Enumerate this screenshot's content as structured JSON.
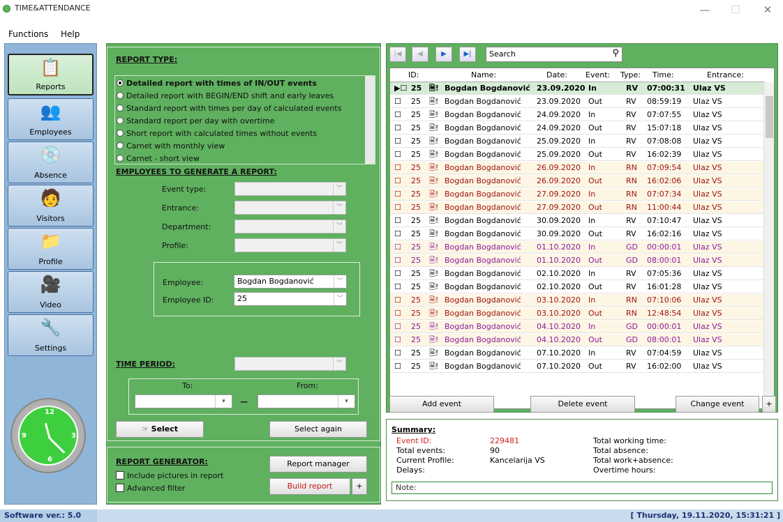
{
  "app": {
    "title": "TIME&ATTENDANCE"
  },
  "menu": [
    "Functions",
    "Help"
  ],
  "sidebar": [
    {
      "label": "Reports",
      "icon": "reports-icon"
    },
    {
      "label": "Employees",
      "icon": "employees-icon"
    },
    {
      "label": "Absence",
      "icon": "absence-icon"
    },
    {
      "label": "Visitors",
      "icon": "visitors-icon"
    },
    {
      "label": "Profile",
      "icon": "profile-icon"
    },
    {
      "label": "Video",
      "icon": "video-icon"
    },
    {
      "label": "Settings",
      "icon": "settings-icon"
    }
  ],
  "report_type": {
    "heading": "REPORT TYPE:",
    "options": [
      "Detailed report with times of IN/OUT events",
      "Detailed report with BEGIN/END shift and early leaves",
      "Standard report with times per day of calculated events",
      "Standard report per day with overtime",
      "Short report with calculated times without events",
      "Carnet with monthly view",
      "Carnet - short view"
    ]
  },
  "employees": {
    "heading": "EMPLOYEES TO GENERATE A REPORT:",
    "event_type": "Event type:",
    "entrance": "Entrance:",
    "department": "Department:",
    "profile": "Profile:",
    "employee_label": "Employee:",
    "employee_value": "Bogdan Bogdanović",
    "employee_id_label": "Employee ID:",
    "employee_id_value": "25"
  },
  "time_period": {
    "heading": "TIME PERIOD:",
    "to": "To:",
    "from": "From:"
  },
  "buttons": {
    "select": "Select",
    "select_again": "Select again",
    "report_manager": "Report manager",
    "build_report": "Build report",
    "plus": "+",
    "add_event": "Add event",
    "delete_event": "Delete event",
    "change_event": "Change event"
  },
  "generator": {
    "heading": "REPORT GENERATOR:",
    "include_pictures": "Include pictures in report",
    "advanced_filter": "Advanced filter"
  },
  "search": {
    "placeholder": "Search"
  },
  "table": {
    "headers": [
      "ID:",
      "Name:",
      "Date:",
      "Event:",
      "Type:",
      "Time:",
      "Entrance:"
    ],
    "rows": [
      [
        "25",
        "Bogdan Bogdanović",
        "23.09.2020",
        "In",
        "RV",
        "07:00:31",
        "Ulaz VS"
      ],
      [
        "25",
        "Bogdan Bogdanović",
        "23.09.2020",
        "Out",
        "RV",
        "08:59:19",
        "Ulaz VS"
      ],
      [
        "25",
        "Bogdan Bogdanović",
        "24.09.2020",
        "In",
        "RV",
        "07:07:55",
        "Ulaz VS"
      ],
      [
        "25",
        "Bogdan Bogdanović",
        "24.09.2020",
        "Out",
        "RV",
        "15:07:18",
        "Ulaz VS"
      ],
      [
        "25",
        "Bogdan Bogdanović",
        "25.09.2020",
        "In",
        "RV",
        "07:08:08",
        "Ulaz VS"
      ],
      [
        "25",
        "Bogdan Bogdanović",
        "25.09.2020",
        "Out",
        "RV",
        "16:02:39",
        "Ulaz VS"
      ],
      [
        "25",
        "Bogdan Bogdanović",
        "26.09.2020",
        "In",
        "RN",
        "07:09:54",
        "Ulaz VS"
      ],
      [
        "25",
        "Bogdan Bogdanović",
        "26.09.2020",
        "Out",
        "RN",
        "16:02:06",
        "Ulaz VS"
      ],
      [
        "25",
        "Bogdan Bogdanović",
        "27.09.2020",
        "In",
        "RN",
        "07:07:34",
        "Ulaz VS"
      ],
      [
        "25",
        "Bogdan Bogdanović",
        "27.09.2020",
        "Out",
        "RN",
        "11:00:44",
        "Ulaz VS"
      ],
      [
        "25",
        "Bogdan Bogdanović",
        "30.09.2020",
        "In",
        "RV",
        "07:10:47",
        "Ulaz VS"
      ],
      [
        "25",
        "Bogdan Bogdanović",
        "30.09.2020",
        "Out",
        "RV",
        "16:02:16",
        "Ulaz VS"
      ],
      [
        "25",
        "Bogdan Bogdanović",
        "01.10.2020",
        "In",
        "GD",
        "00:00:01",
        "Ulaz VS"
      ],
      [
        "25",
        "Bogdan Bogdanović",
        "01.10.2020",
        "Out",
        "GD",
        "08:00:01",
        "Ulaz VS"
      ],
      [
        "25",
        "Bogdan Bogdanović",
        "02.10.2020",
        "In",
        "RV",
        "07:05:36",
        "Ulaz VS"
      ],
      [
        "25",
        "Bogdan Bogdanović",
        "02.10.2020",
        "Out",
        "RV",
        "16:01:28",
        "Ulaz VS"
      ],
      [
        "25",
        "Bogdan Bogdanović",
        "03.10.2020",
        "In",
        "RN",
        "07:10:06",
        "Ulaz VS"
      ],
      [
        "25",
        "Bogdan Bogdanović",
        "03.10.2020",
        "Out",
        "RN",
        "12:48:54",
        "Ulaz VS"
      ],
      [
        "25",
        "Bogdan Bogdanović",
        "04.10.2020",
        "In",
        "GD",
        "00:00:01",
        "Ulaz VS"
      ],
      [
        "25",
        "Bogdan Bogdanović",
        "04.10.2020",
        "Out",
        "GD",
        "08:00:01",
        "Ulaz VS"
      ],
      [
        "25",
        "Bogdan Bogdanović",
        "07.10.2020",
        "In",
        "RV",
        "07:04:59",
        "Ulaz VS"
      ],
      [
        "25",
        "Bogdan Bogdanović",
        "07.10.2020",
        "Out",
        "RV",
        "16:02:00",
        "Ulaz VS"
      ]
    ]
  },
  "summary": {
    "heading": "Summary:",
    "event_id_label": "Event ID:",
    "event_id": "229481",
    "total_events_label": "Total events:",
    "total_events": "90",
    "profile_label": "Current Profile:",
    "profile": "Kancelarija VS",
    "delays_label": "Delays:",
    "total_working": "Total working time:",
    "total_absence": "Total absence:",
    "total_work_absence": "Total work+absence:",
    "overtime": "Overtime hours:",
    "note": "Note:"
  },
  "status": {
    "version": "Software ver.: 5.0",
    "datetime": "[ Thursday, 19.11.2020, 15:31:21 ]"
  }
}
